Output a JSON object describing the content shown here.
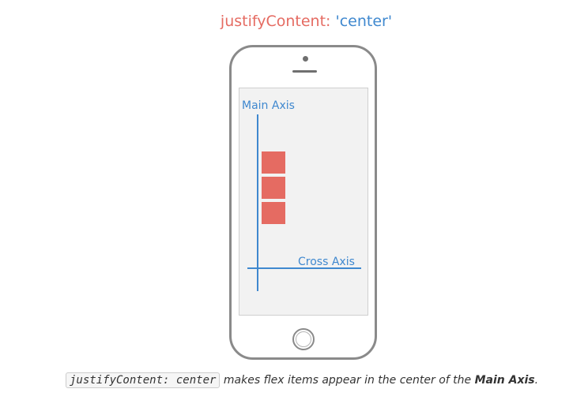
{
  "title": {
    "property": "justifyContent: ",
    "value": "'center'"
  },
  "diagram": {
    "main_axis_label": "Main Axis",
    "cross_axis_label": "Cross Axis",
    "item_color": "#e56b62",
    "axis_color": "#3f88cf",
    "flex_item_count": 3
  },
  "caption": {
    "code": "justifyContent: center",
    "text": " makes flex items appear in the center of the ",
    "emphasis": "Main Axis",
    "end": "."
  }
}
